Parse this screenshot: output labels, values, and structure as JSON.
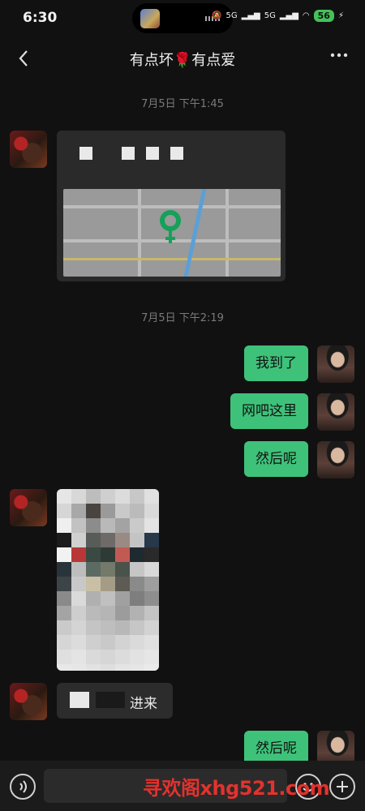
{
  "status_bar": {
    "time": "6:30",
    "signal_labels": [
      "5G",
      "5G"
    ],
    "battery": "56"
  },
  "header": {
    "title": "有点坏🌹有点爱"
  },
  "messages": {
    "ts1": "7月5日 下午1:45",
    "ts2": "7月5日 下午2:19",
    "m1": "我到了",
    "m2": "网吧这里",
    "m3": "然后呢",
    "m4": "进来",
    "m5": "然后呢"
  },
  "watermark": "寻欢阁xhg521.com",
  "colors": {
    "accent_green": "#3ec27a",
    "background": "#111111",
    "bubble_dark": "#2c2c2c",
    "watermark": "#e3322d"
  }
}
